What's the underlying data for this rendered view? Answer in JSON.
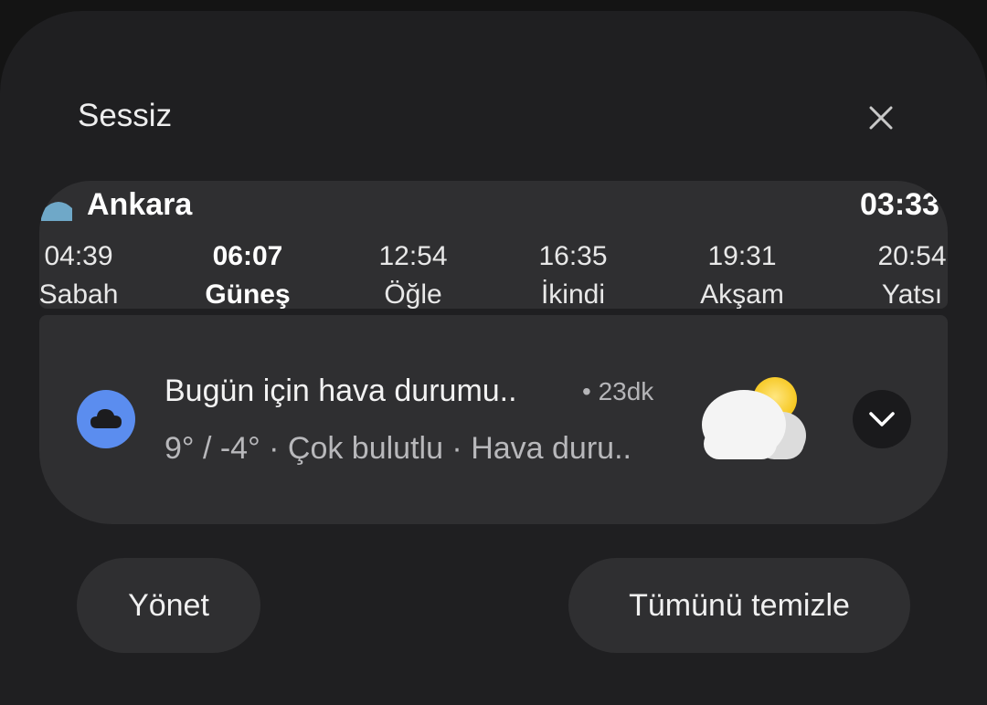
{
  "section_title": "Sessiz",
  "prayer_widget": {
    "city": "Ankara",
    "clock": "03:33",
    "prayers": [
      {
        "time": "04:39",
        "name": "Sabah",
        "active": false
      },
      {
        "time": "06:07",
        "name": "Güneş",
        "active": true
      },
      {
        "time": "12:54",
        "name": "Öğle",
        "active": false
      },
      {
        "time": "16:35",
        "name": "İkindi",
        "active": false
      },
      {
        "time": "19:31",
        "name": "Akşam",
        "active": false
      },
      {
        "time": "20:54",
        "name": "Yatsı",
        "active": false
      }
    ]
  },
  "weather_notification": {
    "app_icon": "cloud-icon",
    "title": "Bugün için hava durumu..",
    "time": "• 23dk",
    "text": "9° / -4° · Çok bulutlu · Hava duru..",
    "image": "partly-cloudy-icon"
  },
  "buttons": {
    "manage": "Yönet",
    "clear_all": "Tümünü temizle"
  },
  "colors": {
    "background": "#1f1f21",
    "card": "#2f2f31",
    "accent_blue": "#5b8def",
    "sun": "#f5c518"
  }
}
